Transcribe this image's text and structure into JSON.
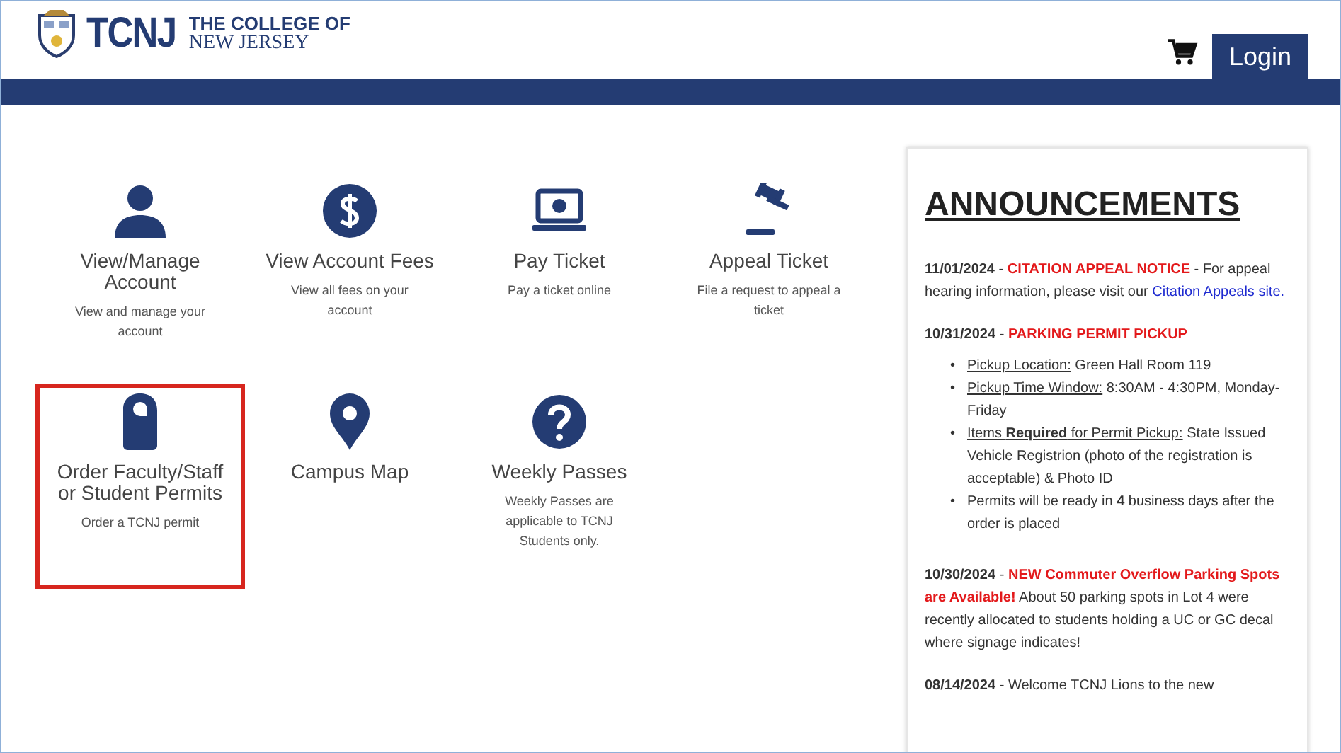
{
  "header": {
    "logo_mark": "TCNJ",
    "logo_line_1": "THE COLLEGE OF",
    "logo_line_2": "NEW JERSEY",
    "login": "Login"
  },
  "tiles": [
    {
      "kind": "person",
      "title": "View/Manage Account",
      "text": "View and manage your account",
      "highlighted": false
    },
    {
      "kind": "dollar",
      "title": "View Account Fees",
      "text": "View all fees on your account",
      "highlighted": false
    },
    {
      "kind": "laptop",
      "title": "Pay Ticket",
      "text": "Pay a ticket online",
      "highlighted": false
    },
    {
      "kind": "gavel",
      "title": "Appeal Ticket",
      "text": "File a request to appeal a ticket",
      "highlighted": false
    },
    {
      "kind": "hanger",
      "title": "Order Faculty/Staff or Student Permits",
      "text": "Order a TCNJ permit",
      "highlighted": true
    },
    {
      "kind": "pin",
      "title": "Campus Map",
      "highlighted": false
    },
    {
      "kind": "question",
      "title": "Weekly Passes",
      "text": "Weekly Passes are applicable to TCNJ Students only.",
      "highlighted": false
    }
  ],
  "announcements": {
    "title": "ANNOUNCEMENTS",
    "items": [
      {
        "date": "11/01/2024",
        "dash": "-",
        "headline": "CITATION APPEAL NOTICE",
        "text": "- For appeal hearing information, please visit our",
        "link": "Citation Appeals site."
      },
      {
        "date": "10/31/2024",
        "dash": "-",
        "headline": "PARKING PERMIT PICKUP",
        "bullets": [
          {
            "marker": "•",
            "label": "Pickup Location:",
            "text": "Green Hall Room 119"
          },
          {
            "marker": "•",
            "label": "Pickup Time Window:",
            "text": "8:30AM - 4:30PM, Monday-Friday"
          },
          {
            "marker": "•",
            "label": "Items **Required** for Permit Pickup:",
            "text": "State Issued Vehicle Registrion (photo of the registration is acceptable) & Photo ID"
          },
          {
            "marker": "•",
            "text": "Permits will be ready in **4** business days after the order is placed"
          }
        ]
      },
      {
        "date": "10/30/2024",
        "dash": "-",
        "headline": "NEW Commuter Overflow Parking Spots are Available!",
        "text": "About 50 parking spots in Lot 4 were recently allocated to students holding a UC or GC decal where signage indicates!"
      },
      {
        "date": "08/14/2024",
        "text": "- Welcome TCNJ Lions to the new"
      }
    ]
  }
}
